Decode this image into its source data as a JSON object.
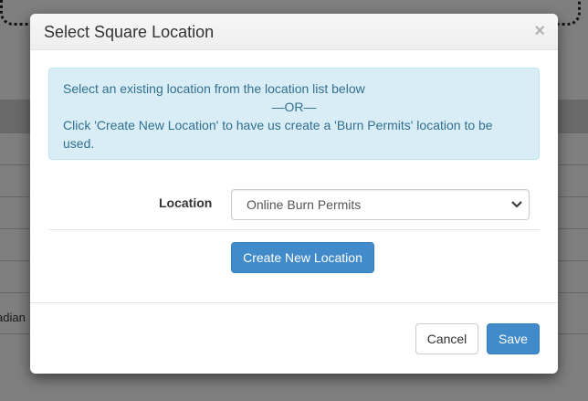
{
  "background": {
    "partial_text": "adian"
  },
  "modal": {
    "title": "Select Square Location",
    "close_glyph": "×",
    "info": {
      "line1": "Select an existing location from the location list below",
      "line2": "—OR—",
      "line3": "Click 'Create New Location' to have us create a 'Burn Permits' location to be used."
    },
    "location_label": "Location",
    "location_value": "Online Burn Permits",
    "create_button": "Create New Location",
    "cancel_button": "Cancel",
    "save_button": "Save"
  },
  "colors": {
    "primary": "#428bca",
    "info_bg": "#d9edf7",
    "info_text": "#31708f"
  },
  "icons": {
    "close": "close-icon",
    "select_arrow": "chevron-down-icon"
  }
}
